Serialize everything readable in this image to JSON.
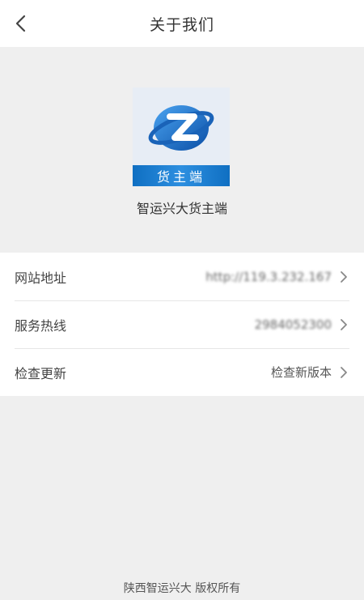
{
  "nav": {
    "title": "关于我们",
    "back_icon": "chevron-left-icon"
  },
  "app": {
    "name": "智运兴大货主端",
    "logo_band_text": "货主端"
  },
  "rows": [
    {
      "label": "网站地址",
      "value": "http://119.3.232.167"
    },
    {
      "label": "服务热线",
      "value": "2984052300"
    },
    {
      "label": "检查更新",
      "value": "检查新版本"
    }
  ],
  "footer": {
    "copyright": "陕西智运兴大 版权所有"
  },
  "colors": {
    "accent": "#1a6fc0",
    "background": "#efefef"
  }
}
